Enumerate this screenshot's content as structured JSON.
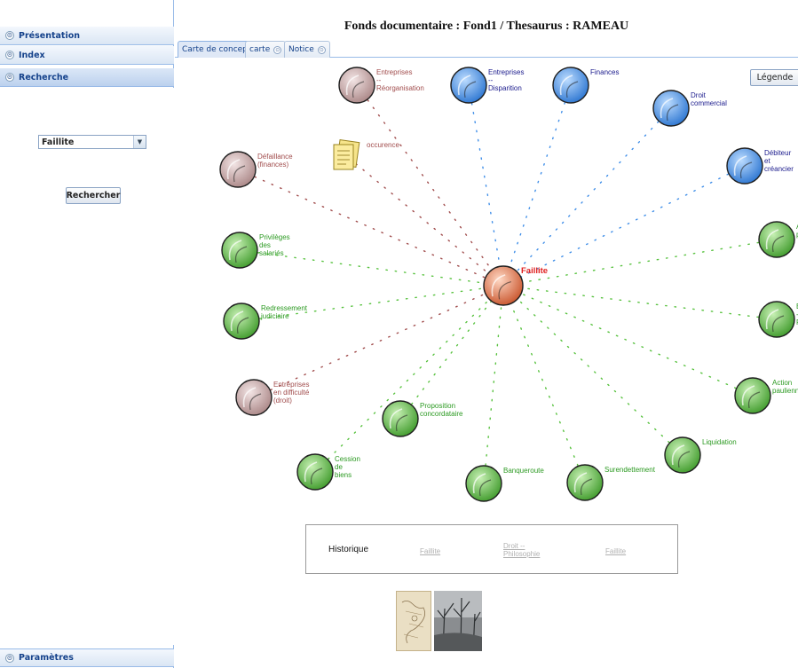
{
  "accordion": {
    "presentation": "Présentation",
    "index": "Index",
    "recherche": "Recherche",
    "parametres": "Paramètres",
    "toggle_glyph": "⊙"
  },
  "search": {
    "selected_term": "Faillite",
    "button_label": "Rechercher"
  },
  "header": {
    "title": "Fonds documentaire : Fond1 / Thesaurus : RAMEAU"
  },
  "tabs": [
    {
      "label": "Carte de concept",
      "active": true,
      "closable": false
    },
    {
      "label": "carte",
      "active": false,
      "closable": true
    },
    {
      "label": "Notice",
      "active": false,
      "closable": true
    }
  ],
  "legend_button": "Légende",
  "occurrence_label": "occurence",
  "center_term": "Faillite",
  "colors": {
    "generic_node": "#c9a6a6",
    "specific_node": "#3f8ee8",
    "related_node": "#58c23f",
    "center_node": "#e07040",
    "generic_text": "#a14d4d",
    "specific_text": "#1a1a8c",
    "related_text": "#2c9a22",
    "center_text": "#e02020"
  },
  "nodes": [
    {
      "id": "entreprises-reorganisation",
      "label": "Entreprises\n--\nRéorganisation",
      "kind": "generic"
    },
    {
      "id": "entreprises-disparition",
      "label": "Entreprises\n--\nDisparition",
      "kind": "specific"
    },
    {
      "id": "finances",
      "label": "Finances",
      "kind": "specific"
    },
    {
      "id": "droit-commercial",
      "label": "Droit\ncommercial",
      "kind": "specific"
    },
    {
      "id": "debiteur-creancier",
      "label": "Débiteur\net\ncréancier",
      "kind": "specific"
    },
    {
      "id": "defaillance-finances",
      "label": "Défaillance\n(finances)",
      "kind": "generic"
    },
    {
      "id": "privileges-salaries",
      "label": "Privilèges\ndes\nsalariés",
      "kind": "related"
    },
    {
      "id": "redressement-judiciaire",
      "label": "Redressement\njudiciaire",
      "kind": "related"
    },
    {
      "id": "entreprises-difficulte",
      "label": "Entreprises\nen difficulté\n(droit)",
      "kind": "generic"
    },
    {
      "id": "cession-biens",
      "label": "Cession\nde\nbiens",
      "kind": "related"
    },
    {
      "id": "proposition-concordataire",
      "label": "Proposition\nconcordataire",
      "kind": "related"
    },
    {
      "id": "banqueroute",
      "label": "Banqueroute",
      "kind": "related"
    },
    {
      "id": "surendettement",
      "label": "Surendettement",
      "kind": "related"
    },
    {
      "id": "liquidation",
      "label": "Liquidation",
      "kind": "related"
    },
    {
      "id": "action-paulienne",
      "label": "Action\npaulienne",
      "kind": "related"
    },
    {
      "id": "ba-pa",
      "label": "Ba\n--\nPa",
      "kind": "related"
    },
    {
      "id": "ad-pro",
      "label": "Ad\npro",
      "kind": "related"
    }
  ],
  "history": {
    "title": "Historique",
    "links": [
      "Faillite",
      "Droit --\nPhilosophie",
      "Faillite"
    ]
  }
}
